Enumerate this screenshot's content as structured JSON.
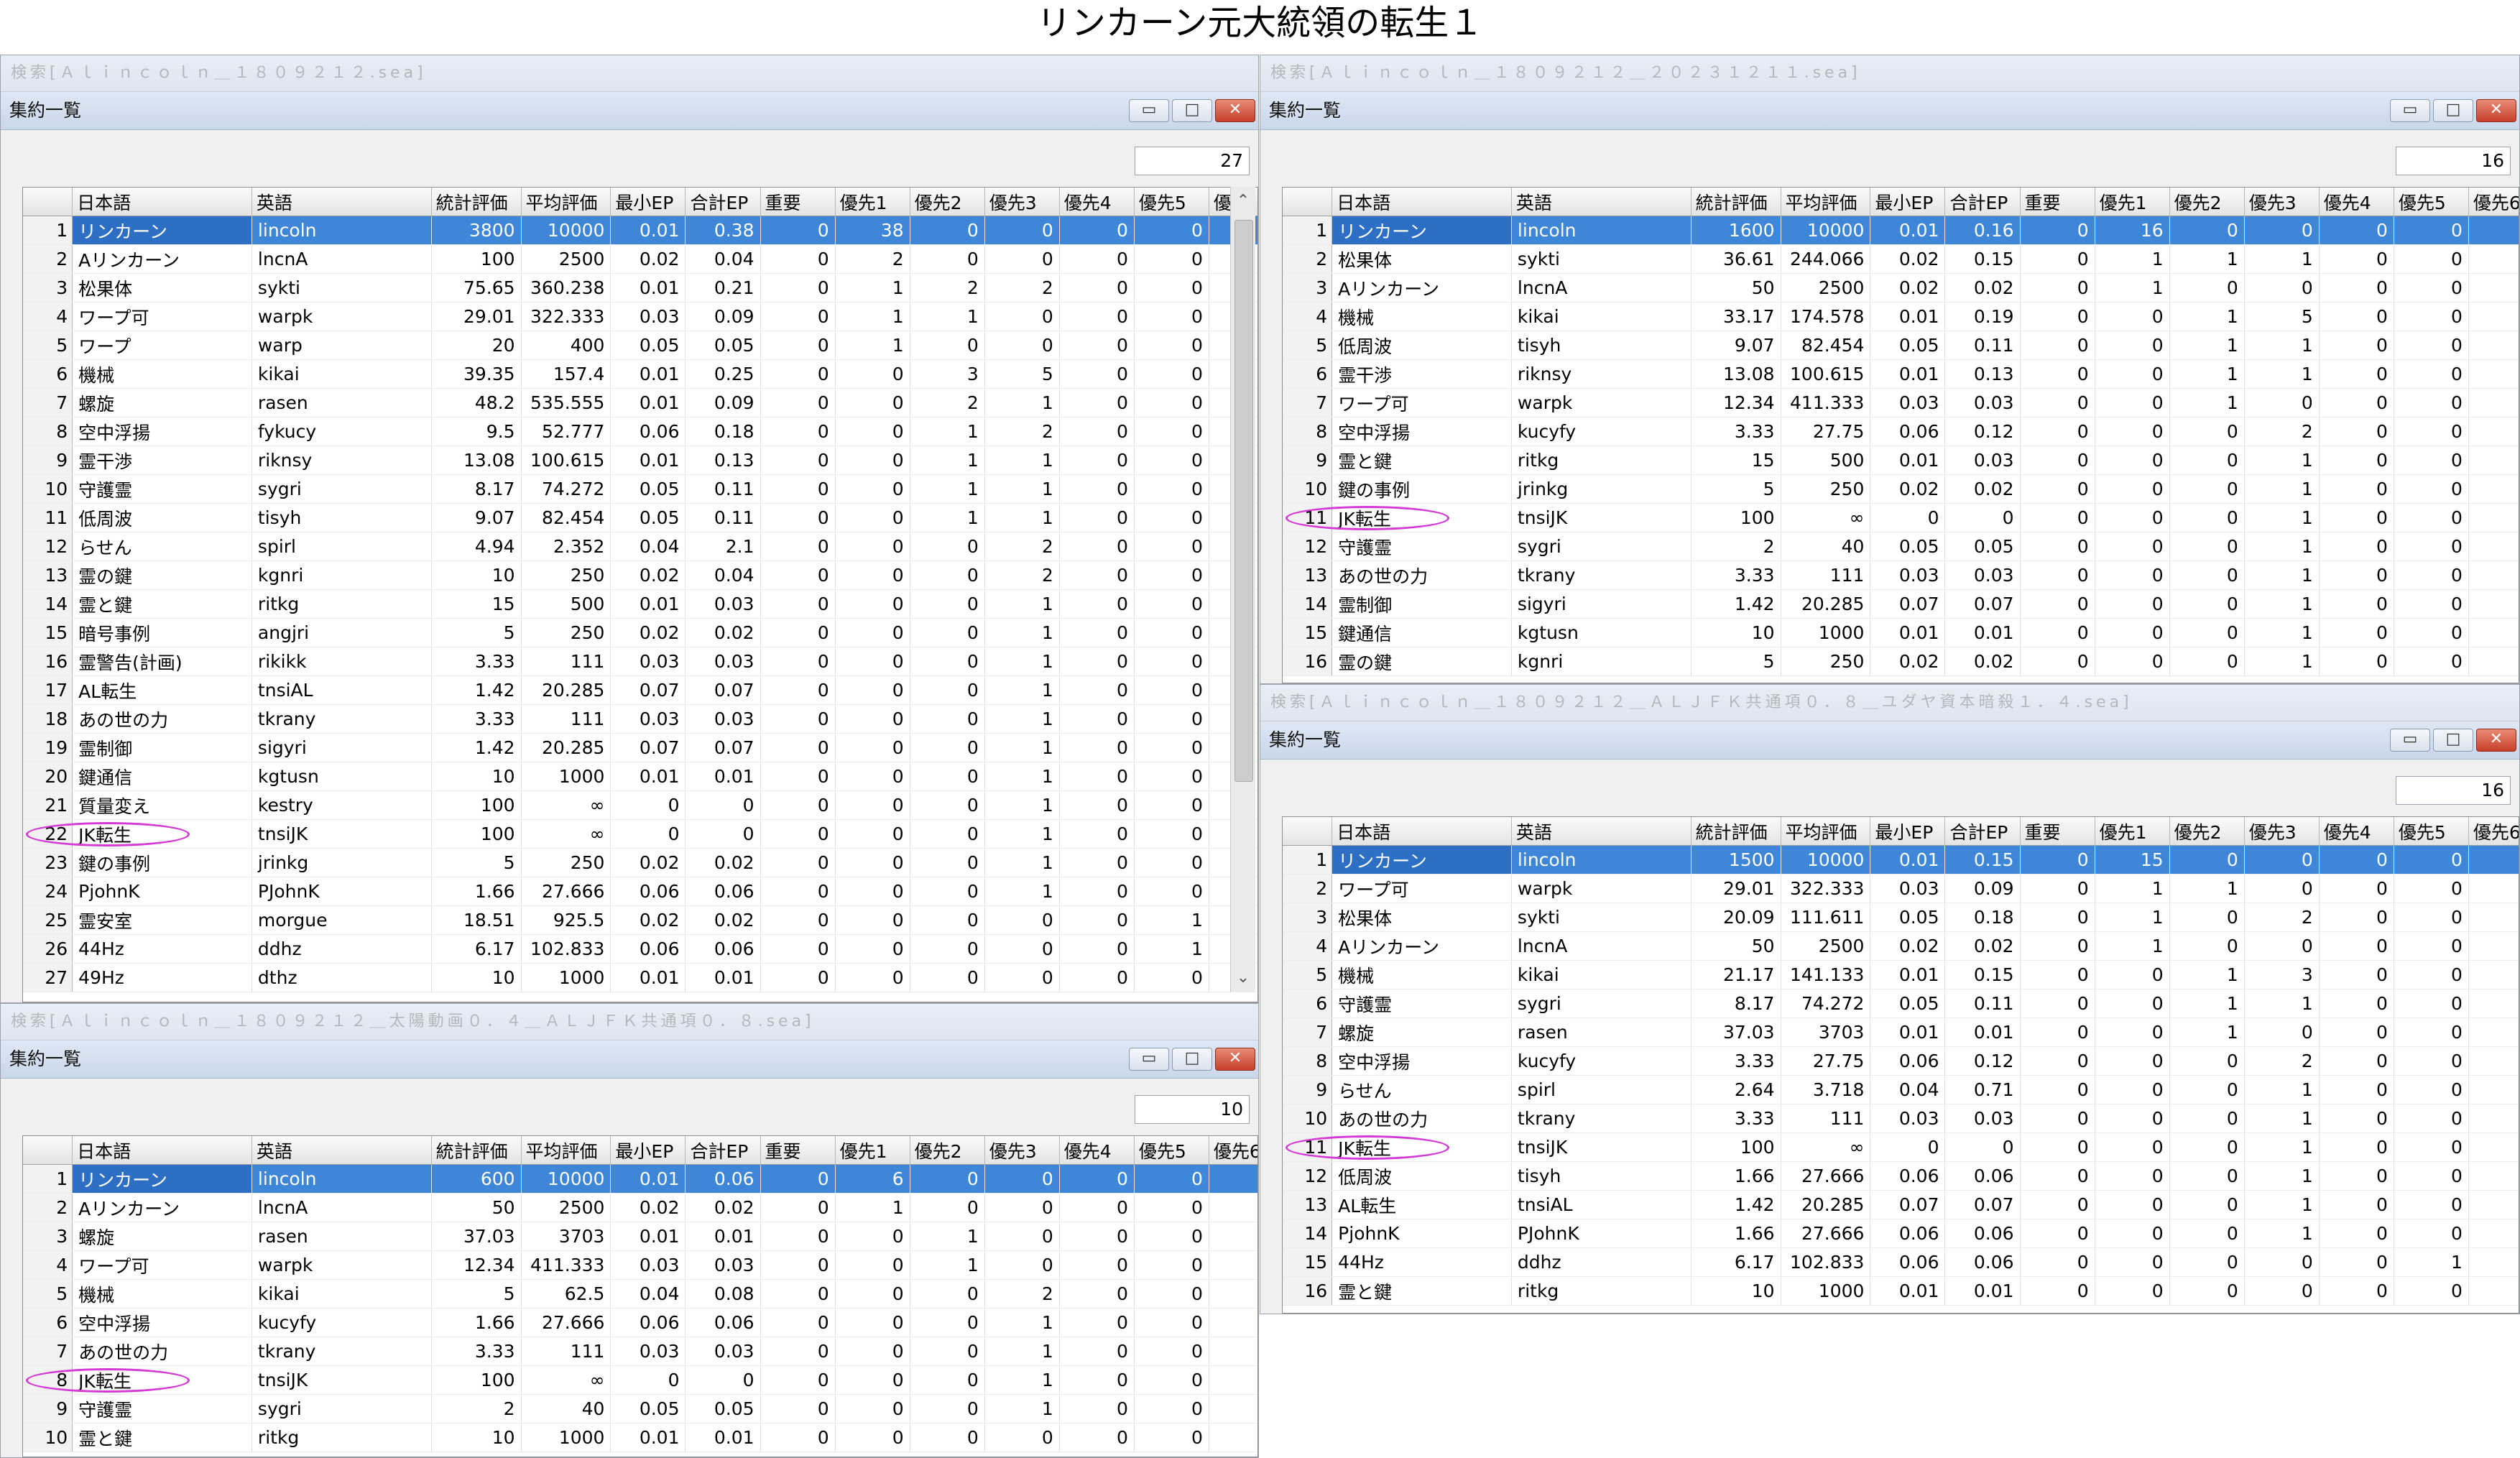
{
  "page_title": "リンカーン元大統領の転生１",
  "windows": {
    "tl": {
      "caption": "検索[Ａｌｉｎｃｏｌｎ＿１８０９２１２.sea]",
      "title": "集約一覧",
      "count": "27",
      "mark_row": 21,
      "headers": [
        "日本語",
        "英語",
        "統計評価",
        "平均評価",
        "最小EP",
        "合計EP",
        "重要",
        "優先1",
        "優先2",
        "優先3",
        "優先4",
        "優先5",
        "優先"
      ],
      "rows": [
        [
          "1",
          "リンカーン",
          "lincoln",
          "3800",
          "10000",
          "0.01",
          "0.38",
          "0",
          "38",
          "0",
          "0",
          "0",
          "0",
          "0"
        ],
        [
          "2",
          "Aリンカーン",
          "lncnA",
          "100",
          "2500",
          "0.02",
          "0.04",
          "0",
          "2",
          "0",
          "0",
          "0",
          "0",
          "0"
        ],
        [
          "3",
          "松果体",
          "sykti",
          "75.65",
          "360.238",
          "0.01",
          "0.21",
          "0",
          "1",
          "2",
          "2",
          "0",
          "0",
          "0"
        ],
        [
          "4",
          "ワープ可",
          "warpk",
          "29.01",
          "322.333",
          "0.03",
          "0.09",
          "0",
          "1",
          "1",
          "0",
          "0",
          "0",
          "0"
        ],
        [
          "5",
          "ワープ",
          "warp",
          "20",
          "400",
          "0.05",
          "0.05",
          "0",
          "1",
          "0",
          "0",
          "0",
          "0",
          "0"
        ],
        [
          "6",
          "機械",
          "kikai",
          "39.35",
          "157.4",
          "0.01",
          "0.25",
          "0",
          "0",
          "3",
          "5",
          "0",
          "0",
          "0"
        ],
        [
          "7",
          "螺旋",
          "rasen",
          "48.2",
          "535.555",
          "0.01",
          "0.09",
          "0",
          "0",
          "2",
          "1",
          "0",
          "0",
          "0"
        ],
        [
          "8",
          "空中浮揚",
          "fykucy",
          "9.5",
          "52.777",
          "0.06",
          "0.18",
          "0",
          "0",
          "1",
          "2",
          "0",
          "0",
          "0"
        ],
        [
          "9",
          "霊干渉",
          "riknsy",
          "13.08",
          "100.615",
          "0.01",
          "0.13",
          "0",
          "0",
          "1",
          "1",
          "0",
          "0",
          "0"
        ],
        [
          "10",
          "守護霊",
          "sygri",
          "8.17",
          "74.272",
          "0.05",
          "0.11",
          "0",
          "0",
          "1",
          "1",
          "0",
          "0",
          "0"
        ],
        [
          "11",
          "低周波",
          "tisyh",
          "9.07",
          "82.454",
          "0.05",
          "0.11",
          "0",
          "0",
          "1",
          "1",
          "0",
          "0",
          "0"
        ],
        [
          "12",
          "らせん",
          "spirl",
          "4.94",
          "2.352",
          "0.04",
          "2.1",
          "0",
          "0",
          "0",
          "2",
          "0",
          "0",
          "0"
        ],
        [
          "13",
          "霊の鍵",
          "kgnri",
          "10",
          "250",
          "0.02",
          "0.04",
          "0",
          "0",
          "0",
          "2",
          "0",
          "0",
          "0"
        ],
        [
          "14",
          "霊と鍵",
          "ritkg",
          "15",
          "500",
          "0.01",
          "0.03",
          "0",
          "0",
          "0",
          "1",
          "0",
          "0",
          "0"
        ],
        [
          "15",
          "暗号事例",
          "angjri",
          "5",
          "250",
          "0.02",
          "0.02",
          "0",
          "0",
          "0",
          "1",
          "0",
          "0",
          "0"
        ],
        [
          "16",
          "霊警告(計画)",
          "rikikk",
          "3.33",
          "111",
          "0.03",
          "0.03",
          "0",
          "0",
          "0",
          "1",
          "0",
          "0",
          "0"
        ],
        [
          "17",
          "AL転生",
          "tnsiAL",
          "1.42",
          "20.285",
          "0.07",
          "0.07",
          "0",
          "0",
          "0",
          "1",
          "0",
          "0",
          "0"
        ],
        [
          "18",
          "あの世の力",
          "tkrany",
          "3.33",
          "111",
          "0.03",
          "0.03",
          "0",
          "0",
          "0",
          "1",
          "0",
          "0",
          "0"
        ],
        [
          "19",
          "霊制御",
          "sigyri",
          "1.42",
          "20.285",
          "0.07",
          "0.07",
          "0",
          "0",
          "0",
          "1",
          "0",
          "0",
          "0"
        ],
        [
          "20",
          "鍵通信",
          "kgtusn",
          "10",
          "1000",
          "0.01",
          "0.01",
          "0",
          "0",
          "0",
          "1",
          "0",
          "0",
          "0"
        ],
        [
          "21",
          "質量変え",
          "kestry",
          "100",
          "∞",
          "0",
          "0",
          "0",
          "0",
          "0",
          "1",
          "0",
          "0",
          "0"
        ],
        [
          "22",
          "JK転生",
          "tnsiJK",
          "100",
          "∞",
          "0",
          "0",
          "0",
          "0",
          "0",
          "1",
          "0",
          "0",
          "0"
        ],
        [
          "23",
          "鍵の事例",
          "jrinkg",
          "5",
          "250",
          "0.02",
          "0.02",
          "0",
          "0",
          "0",
          "1",
          "0",
          "0",
          "0"
        ],
        [
          "24",
          "PjohnK",
          "PJohnK",
          "1.66",
          "27.666",
          "0.06",
          "0.06",
          "0",
          "0",
          "0",
          "1",
          "0",
          "0",
          "0"
        ],
        [
          "25",
          "霊安室",
          "morgue",
          "18.51",
          "925.5",
          "0.02",
          "0.02",
          "0",
          "0",
          "0",
          "0",
          "0",
          "1",
          "0"
        ],
        [
          "26",
          "44Hz",
          "ddhz",
          "6.17",
          "102.833",
          "0.06",
          "0.06",
          "0",
          "0",
          "0",
          "0",
          "0",
          "1",
          "0"
        ],
        [
          "27",
          "49Hz",
          "dthz",
          "10",
          "1000",
          "0.01",
          "0.01",
          "0",
          "0",
          "0",
          "0",
          "0",
          "0",
          "0"
        ]
      ]
    },
    "tr": {
      "caption": "検索[Ａｌｉｎｃｏｌｎ＿１８０９２１２＿２０２３１２１１.sea]",
      "title": "集約一覧",
      "count": "16",
      "mark_row": 10,
      "headers": [
        "日本語",
        "英語",
        "統計評価",
        "平均評価",
        "最小EP",
        "合計EP",
        "重要",
        "優先1",
        "優先2",
        "優先3",
        "優先4",
        "優先5",
        "優先6"
      ],
      "rows": [
        [
          "1",
          "リンカーン",
          "lincoln",
          "1600",
          "10000",
          "0.01",
          "0.16",
          "0",
          "16",
          "0",
          "0",
          "0",
          "0",
          "0"
        ],
        [
          "2",
          "松果体",
          "sykti",
          "36.61",
          "244.066",
          "0.02",
          "0.15",
          "0",
          "1",
          "1",
          "1",
          "0",
          "0",
          "0"
        ],
        [
          "3",
          "Aリンカーン",
          "lncnA",
          "50",
          "2500",
          "0.02",
          "0.02",
          "0",
          "1",
          "0",
          "0",
          "0",
          "0",
          "0"
        ],
        [
          "4",
          "機械",
          "kikai",
          "33.17",
          "174.578",
          "0.01",
          "0.19",
          "0",
          "0",
          "1",
          "5",
          "0",
          "0",
          "0"
        ],
        [
          "5",
          "低周波",
          "tisyh",
          "9.07",
          "82.454",
          "0.05",
          "0.11",
          "0",
          "0",
          "1",
          "1",
          "0",
          "0",
          "0"
        ],
        [
          "6",
          "霊干渉",
          "riknsy",
          "13.08",
          "100.615",
          "0.01",
          "0.13",
          "0",
          "0",
          "1",
          "1",
          "0",
          "0",
          "0"
        ],
        [
          "7",
          "ワープ可",
          "warpk",
          "12.34",
          "411.333",
          "0.03",
          "0.03",
          "0",
          "0",
          "1",
          "0",
          "0",
          "0",
          "0"
        ],
        [
          "8",
          "空中浮揚",
          "kucyfy",
          "3.33",
          "27.75",
          "0.06",
          "0.12",
          "0",
          "0",
          "0",
          "2",
          "0",
          "0",
          "0"
        ],
        [
          "9",
          "霊と鍵",
          "ritkg",
          "15",
          "500",
          "0.01",
          "0.03",
          "0",
          "0",
          "0",
          "1",
          "0",
          "0",
          "1"
        ],
        [
          "10",
          "鍵の事例",
          "jrinkg",
          "5",
          "250",
          "0.02",
          "0.02",
          "0",
          "0",
          "0",
          "1",
          "0",
          "0",
          "0"
        ],
        [
          "11",
          "JK転生",
          "tnsiJK",
          "100",
          "∞",
          "0",
          "0",
          "0",
          "0",
          "0",
          "1",
          "0",
          "0",
          "0"
        ],
        [
          "12",
          "守護霊",
          "sygri",
          "2",
          "40",
          "0.05",
          "0.05",
          "0",
          "0",
          "0",
          "1",
          "0",
          "0",
          "0"
        ],
        [
          "13",
          "あの世の力",
          "tkrany",
          "3.33",
          "111",
          "0.03",
          "0.03",
          "0",
          "0",
          "0",
          "1",
          "0",
          "0",
          "0"
        ],
        [
          "14",
          "霊制御",
          "sigyri",
          "1.42",
          "20.285",
          "0.07",
          "0.07",
          "0",
          "0",
          "0",
          "1",
          "0",
          "0",
          "0"
        ],
        [
          "15",
          "鍵通信",
          "kgtusn",
          "10",
          "1000",
          "0.01",
          "0.01",
          "0",
          "0",
          "0",
          "1",
          "0",
          "0",
          "0"
        ],
        [
          "16",
          "霊の鍵",
          "kgnri",
          "5",
          "250",
          "0.02",
          "0.02",
          "0",
          "0",
          "0",
          "1",
          "0",
          "0",
          "0"
        ]
      ]
    },
    "bl": {
      "caption": "検索[Ａｌｉｎｃｏｌｎ＿１８０９２１２＿太陽動画０．４＿ＡＬＪＦＫ共通項０．８.sea]",
      "title": "集約一覧",
      "count": "10",
      "mark_row": 7,
      "headers": [
        "日本語",
        "英語",
        "統計評価",
        "平均評価",
        "最小EP",
        "合計EP",
        "重要",
        "優先1",
        "優先2",
        "優先3",
        "優先4",
        "優先5",
        "優先6"
      ],
      "rows": [
        [
          "1",
          "リンカーン",
          "lincoln",
          "600",
          "10000",
          "0.01",
          "0.06",
          "0",
          "6",
          "0",
          "0",
          "0",
          "0",
          "0"
        ],
        [
          "2",
          "Aリンカーン",
          "lncnA",
          "50",
          "2500",
          "0.02",
          "0.02",
          "0",
          "1",
          "0",
          "0",
          "0",
          "0",
          "0"
        ],
        [
          "3",
          "螺旋",
          "rasen",
          "37.03",
          "3703",
          "0.01",
          "0.01",
          "0",
          "0",
          "1",
          "0",
          "0",
          "0",
          "0"
        ],
        [
          "4",
          "ワープ可",
          "warpk",
          "12.34",
          "411.333",
          "0.03",
          "0.03",
          "0",
          "0",
          "1",
          "0",
          "0",
          "0",
          "0"
        ],
        [
          "5",
          "機械",
          "kikai",
          "5",
          "62.5",
          "0.04",
          "0.08",
          "0",
          "0",
          "0",
          "2",
          "0",
          "0",
          "0"
        ],
        [
          "6",
          "空中浮揚",
          "kucyfy",
          "1.66",
          "27.666",
          "0.06",
          "0.06",
          "0",
          "0",
          "0",
          "1",
          "0",
          "0",
          "0"
        ],
        [
          "7",
          "あの世の力",
          "tkrany",
          "3.33",
          "111",
          "0.03",
          "0.03",
          "0",
          "0",
          "0",
          "1",
          "0",
          "0",
          "0"
        ],
        [
          "8",
          "JK転生",
          "tnsiJK",
          "100",
          "∞",
          "0",
          "0",
          "0",
          "0",
          "0",
          "1",
          "0",
          "0",
          "0"
        ],
        [
          "9",
          "守護霊",
          "sygri",
          "2",
          "40",
          "0.05",
          "0.05",
          "0",
          "0",
          "0",
          "1",
          "0",
          "0",
          "0"
        ],
        [
          "10",
          "霊と鍵",
          "ritkg",
          "10",
          "1000",
          "0.01",
          "0.01",
          "0",
          "0",
          "0",
          "0",
          "0",
          "0",
          "1"
        ]
      ]
    },
    "br": {
      "caption": "検索[Ａｌｉｎｃｏｌｎ＿１８０９２１２＿ＡＬＪＦＫ共通項０．８＿ユダヤ資本暗殺１．４.sea]",
      "title": "集約一覧",
      "count": "16",
      "mark_row": 10,
      "headers": [
        "日本語",
        "英語",
        "統計評価",
        "平均評価",
        "最小EP",
        "合計EP",
        "重要",
        "優先1",
        "優先2",
        "優先3",
        "優先4",
        "優先5",
        "優先6"
      ],
      "rows": [
        [
          "1",
          "リンカーン",
          "lincoln",
          "1500",
          "10000",
          "0.01",
          "0.15",
          "0",
          "15",
          "0",
          "0",
          "0",
          "0",
          "0"
        ],
        [
          "2",
          "ワープ可",
          "warpk",
          "29.01",
          "322.333",
          "0.03",
          "0.09",
          "0",
          "1",
          "1",
          "0",
          "0",
          "0",
          "0"
        ],
        [
          "3",
          "松果体",
          "sykti",
          "20.09",
          "111.611",
          "0.05",
          "0.18",
          "0",
          "1",
          "0",
          "2",
          "0",
          "0",
          "0"
        ],
        [
          "4",
          "Aリンカーン",
          "lncnA",
          "50",
          "2500",
          "0.02",
          "0.02",
          "0",
          "1",
          "0",
          "0",
          "0",
          "0",
          "0"
        ],
        [
          "5",
          "機械",
          "kikai",
          "21.17",
          "141.133",
          "0.01",
          "0.15",
          "0",
          "0",
          "1",
          "3",
          "0",
          "0",
          "0"
        ],
        [
          "6",
          "守護霊",
          "sygri",
          "8.17",
          "74.272",
          "0.05",
          "0.11",
          "0",
          "0",
          "1",
          "1",
          "0",
          "0",
          "0"
        ],
        [
          "7",
          "螺旋",
          "rasen",
          "37.03",
          "3703",
          "0.01",
          "0.01",
          "0",
          "0",
          "1",
          "0",
          "0",
          "0",
          "0"
        ],
        [
          "8",
          "空中浮揚",
          "kucyfy",
          "3.33",
          "27.75",
          "0.06",
          "0.12",
          "0",
          "0",
          "0",
          "2",
          "0",
          "0",
          "0"
        ],
        [
          "9",
          "らせん",
          "spirl",
          "2.64",
          "3.718",
          "0.04",
          "0.71",
          "0",
          "0",
          "0",
          "1",
          "0",
          "0",
          "1"
        ],
        [
          "10",
          "あの世の力",
          "tkrany",
          "3.33",
          "111",
          "0.03",
          "0.03",
          "0",
          "0",
          "0",
          "1",
          "0",
          "0",
          "0"
        ],
        [
          "11",
          "JK転生",
          "tnsiJK",
          "100",
          "∞",
          "0",
          "0",
          "0",
          "0",
          "0",
          "1",
          "0",
          "0",
          "0"
        ],
        [
          "12",
          "低周波",
          "tisyh",
          "1.66",
          "27.666",
          "0.06",
          "0.06",
          "0",
          "0",
          "0",
          "1",
          "0",
          "0",
          "0"
        ],
        [
          "13",
          "AL転生",
          "tnsiAL",
          "1.42",
          "20.285",
          "0.07",
          "0.07",
          "0",
          "0",
          "0",
          "1",
          "0",
          "0",
          "0"
        ],
        [
          "14",
          "PjohnK",
          "PJohnK",
          "1.66",
          "27.666",
          "0.06",
          "0.06",
          "0",
          "0",
          "0",
          "1",
          "0",
          "0",
          "0"
        ],
        [
          "15",
          "44Hz",
          "ddhz",
          "6.17",
          "102.833",
          "0.06",
          "0.06",
          "0",
          "0",
          "0",
          "0",
          "0",
          "1",
          "0"
        ],
        [
          "16",
          "霊と鍵",
          "ritkg",
          "10",
          "1000",
          "0.01",
          "0.01",
          "0",
          "0",
          "0",
          "0",
          "0",
          "0",
          "1"
        ]
      ]
    }
  }
}
